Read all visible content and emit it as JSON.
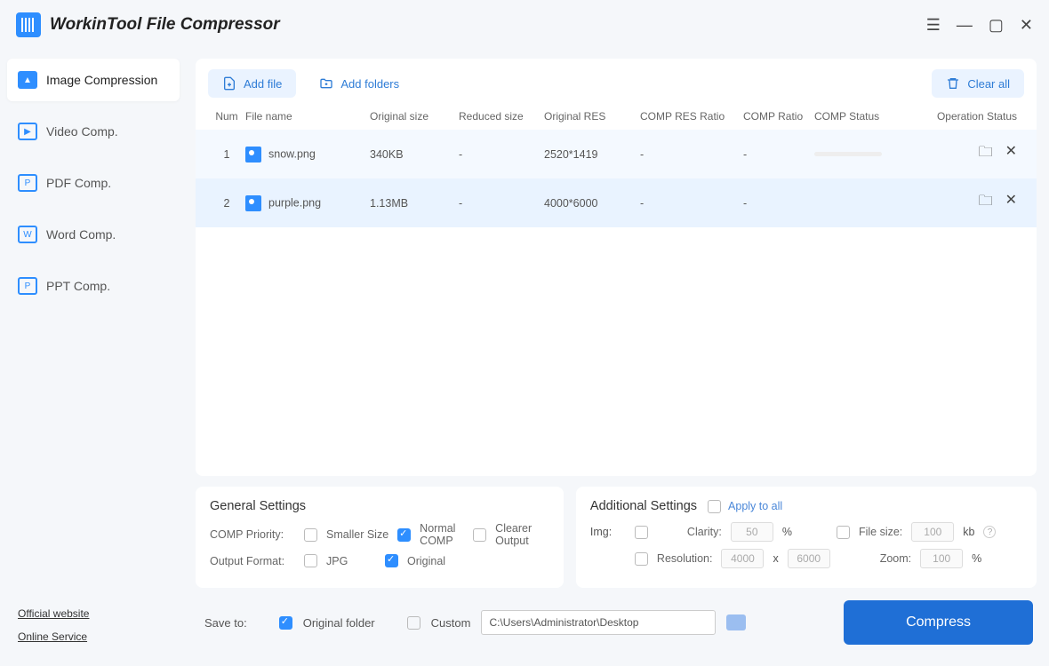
{
  "app_title": "WorkinTool File Compressor",
  "sidebar": {
    "items": [
      {
        "label": "Image Compression"
      },
      {
        "label": "Video Comp."
      },
      {
        "label": "PDF Comp."
      },
      {
        "label": "Word Comp."
      },
      {
        "label": "PPT Comp."
      }
    ],
    "links": {
      "official": "Official website",
      "online": "Online Service"
    }
  },
  "toolbar": {
    "add_file": "Add file",
    "add_folders": "Add folders",
    "clear_all": "Clear all"
  },
  "table": {
    "headers": {
      "num": "Num",
      "filename": "File name",
      "osize": "Original size",
      "rsize": "Reduced size",
      "ores": "Original RES",
      "cresratio": "COMP RES Ratio",
      "compratio": "COMP Ratio",
      "cstatus": "COMP Status",
      "opstatus": "Operation Status"
    },
    "rows": [
      {
        "num": "1",
        "name": "snow.png",
        "osize": "340KB",
        "rsize": "-",
        "ores": "2520*1419",
        "cresratio": "-",
        "compratio": "-"
      },
      {
        "num": "2",
        "name": "purple.png",
        "osize": "1.13MB",
        "rsize": "-",
        "ores": "4000*6000",
        "cresratio": "-",
        "compratio": "-"
      }
    ]
  },
  "general": {
    "title": "General Settings",
    "priority_label": "COMP Priority:",
    "smaller": "Smaller Size",
    "normal": "Normal COMP",
    "clearer": "Clearer Output",
    "output_label": "Output Format:",
    "jpg": "JPG",
    "original": "Original"
  },
  "additional": {
    "title": "Additional Settings",
    "apply": "Apply to all",
    "img": "Img:",
    "clarity": "Clarity:",
    "clarity_val": "50",
    "pct": "%",
    "filesize": "File size:",
    "filesize_val": "100",
    "kb": "kb",
    "resolution": "Resolution:",
    "res_w": "4000",
    "res_x": "x",
    "res_h": "6000",
    "zoom": "Zoom:",
    "zoom_val": "100"
  },
  "saveto": {
    "label": "Save to:",
    "original_folder": "Original folder",
    "custom": "Custom",
    "path": "C:\\Users\\Administrator\\Desktop",
    "compress": "Compress"
  }
}
